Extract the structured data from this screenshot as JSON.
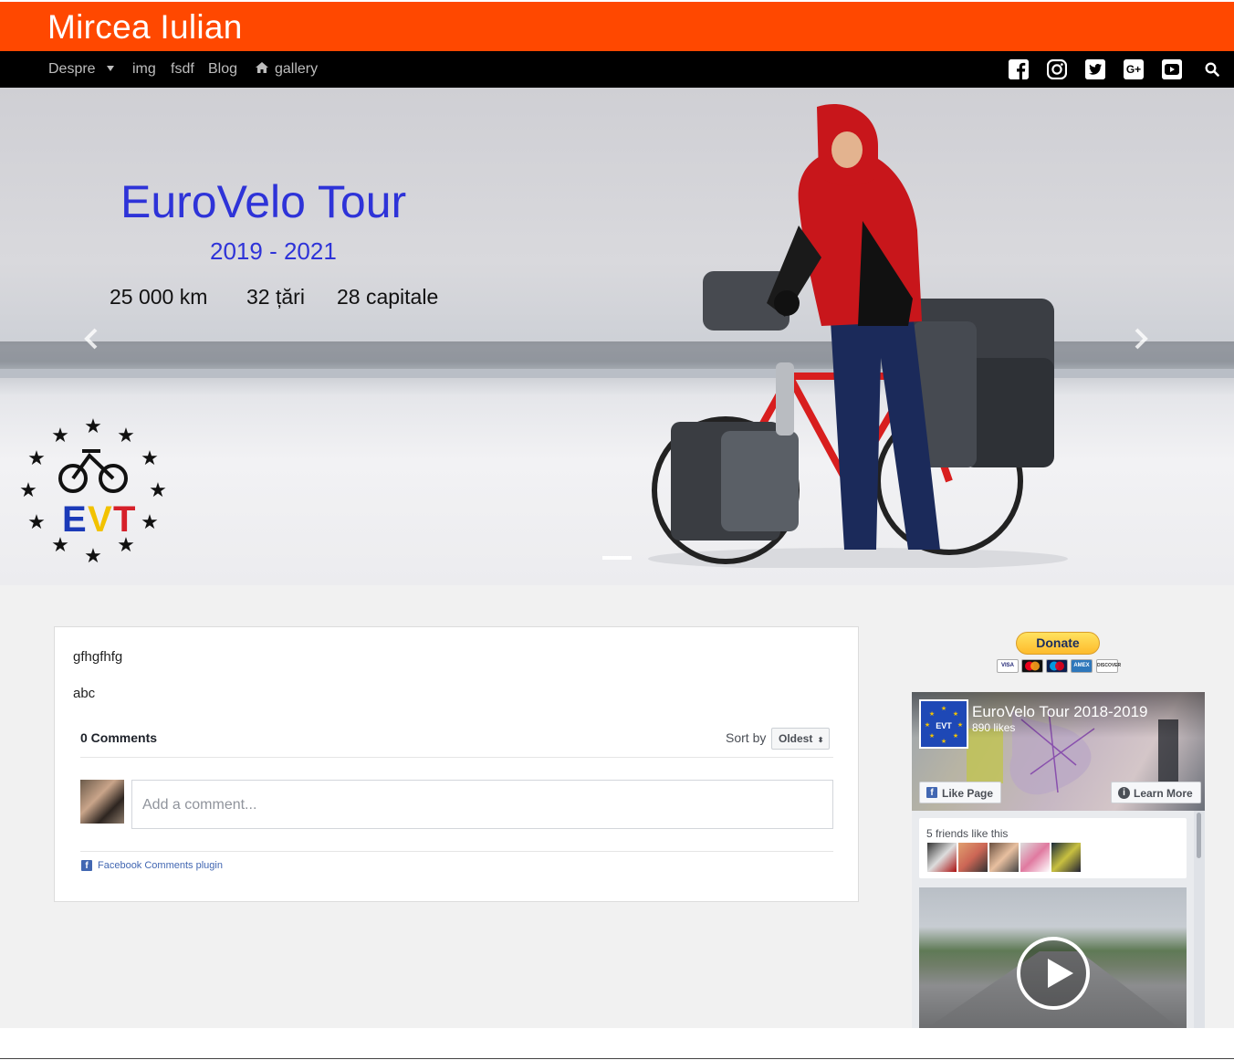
{
  "header": {
    "site_title": "Mircea Iulian",
    "accent_color": "#ff4800"
  },
  "nav": {
    "items": [
      {
        "label": "Despre",
        "has_dropdown": true
      },
      {
        "label": "img"
      },
      {
        "label": "fsdf"
      },
      {
        "label": "Blog"
      },
      {
        "label": "gallery",
        "icon": "home-icon"
      }
    ],
    "social_icons": [
      "facebook-icon",
      "instagram-icon",
      "twitter-icon",
      "google-plus-icon",
      "youtube-icon"
    ],
    "search_icon": "search-icon"
  },
  "hero": {
    "title": "EuroVelo Tour",
    "years": "2019 - 2021",
    "stats": [
      "25 000 km",
      "32 țări",
      "28 capitale"
    ],
    "logo_letters": "EVT"
  },
  "post": {
    "paragraphs": [
      "gfhgfhfg",
      "abc"
    ]
  },
  "comments": {
    "count_label": "0 Comments",
    "sort_label": "Sort by",
    "sort_value": "Oldest",
    "placeholder": "Add a comment...",
    "plugin_label": "Facebook Comments plugin"
  },
  "sidebar": {
    "donate_label": "Donate",
    "cards": [
      "VISA",
      "MC",
      "Maestro",
      "AMEX",
      "DISCOVER"
    ],
    "fb_page": {
      "name": "EuroVelo Tour 2018-2019",
      "likes": "890 likes",
      "like_button": "Like Page",
      "learn_more_button": "Learn More",
      "friends_label": "5 friends like this"
    }
  }
}
